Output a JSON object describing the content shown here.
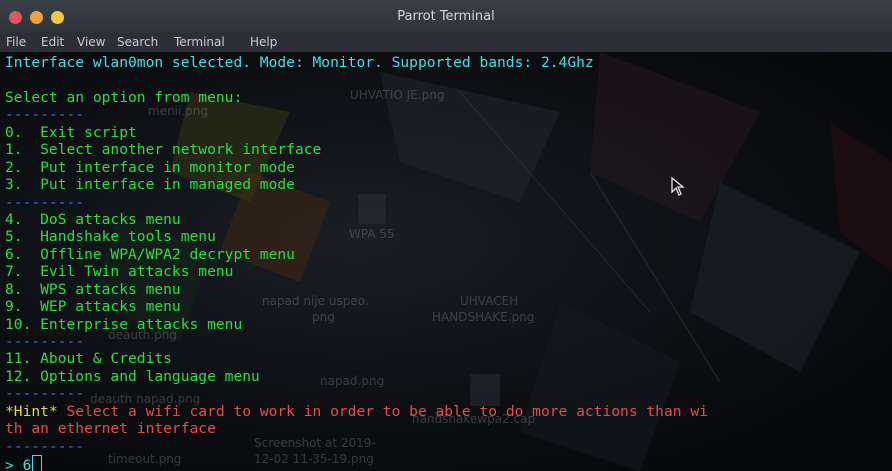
{
  "window": {
    "title": "Parrot Terminal"
  },
  "menubar": {
    "items": [
      "File",
      "Edit",
      "View",
      "Search",
      "Terminal",
      "Help"
    ]
  },
  "terminal": {
    "status_line": "Interface wlan0mon selected. Mode: Monitor. Supported bands: 2.4Ghz",
    "blank": "",
    "menu_prompt": "Select an option from menu:",
    "separator": "---------",
    "options": [
      "0.  Exit script",
      "1.  Select another network interface",
      "2.  Put interface in monitor mode",
      "3.  Put interface in managed mode",
      "4.  DoS attacks menu",
      "5.  Handshake tools menu",
      "6.  Offline WPA/WPA2 decrypt menu",
      "7.  Evil Twin attacks menu",
      "8.  WPS attacks menu",
      "9.  WEP attacks menu",
      "10. Enterprise attacks menu",
      "11. About & Credits",
      "12. Options and language menu"
    ],
    "hint_tag": "*Hint*",
    "hint_text_1": " Select a wifi card to work in order to be able to do more actions than wi",
    "hint_text_2": "th an ethernet interface",
    "prompt_symbol": "> ",
    "input_value": "6"
  },
  "desktop_labels": [
    "UHVATIO JE.png",
    "menii.png",
    "WPA 55",
    "napad nije uspeo.",
    "png",
    "UHVACEH",
    "HANDSHAKE.png",
    "Screenshot at 2019-",
    "12-02 11-35-19.png",
    "napad.png",
    "deauth napad.png",
    "handshakewpa2.cap",
    "timeout.png",
    "deauth.png"
  ],
  "colors": {
    "option_green": "#27e03f",
    "status_cyan": "#41e0e6",
    "separator_blue": "#3c6fe0",
    "hint_red": "#e74c4c",
    "hint_yellow": "#e8d43b"
  },
  "icons": {
    "mouse_pointer": "arrow-cursor-icon"
  }
}
